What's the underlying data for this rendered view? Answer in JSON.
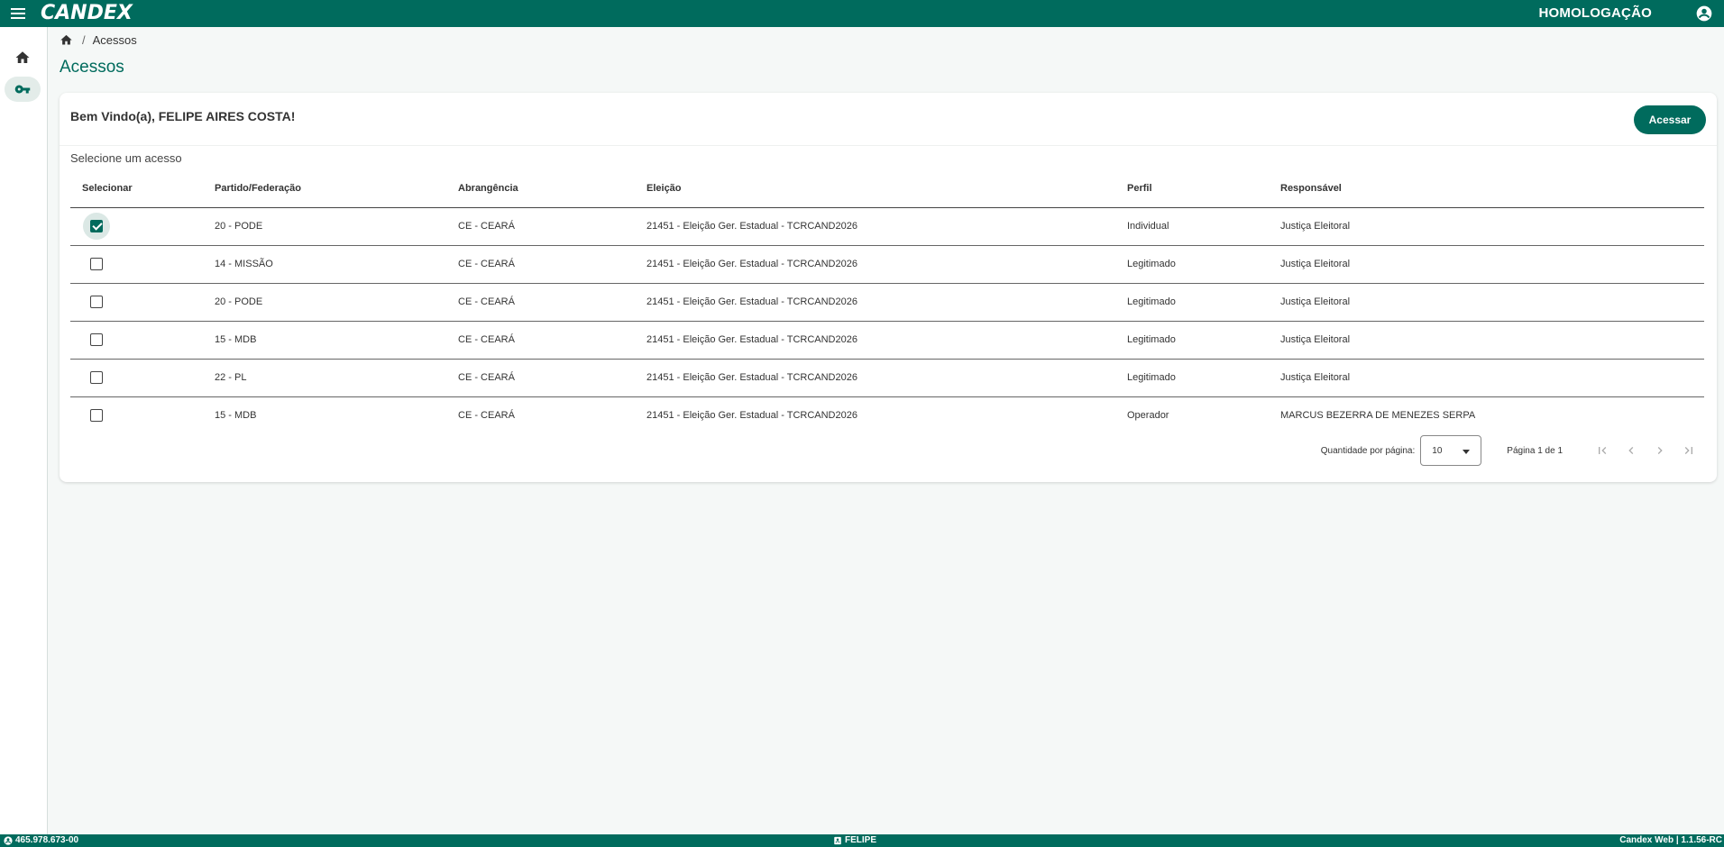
{
  "header": {
    "logo_text": "CANDEX",
    "environment": "HOMOLOGAÇÃO"
  },
  "breadcrumb": {
    "current": "Acessos"
  },
  "page": {
    "title": "Acessos"
  },
  "card": {
    "welcome": "Bem Vindo(a), FELIPE AIRES COSTA!",
    "action_label": "Acessar",
    "subtitle": "Selecione um acesso"
  },
  "table": {
    "columns": [
      "Selecionar",
      "Partido/Federação",
      "Abrangência",
      "Eleição",
      "Perfil",
      "Responsável"
    ],
    "rows": [
      {
        "checked": true,
        "partido": "20 - PODE",
        "abrangencia": "CE - CEARÁ",
        "eleicao": "21451 - Eleição Ger. Estadual - TCRCAND2026",
        "perfil": "Individual",
        "responsavel": "Justiça Eleitoral"
      },
      {
        "checked": false,
        "partido": "14 - MISSÃO",
        "abrangencia": "CE - CEARÁ",
        "eleicao": "21451 - Eleição Ger. Estadual - TCRCAND2026",
        "perfil": "Legitimado",
        "responsavel": "Justiça Eleitoral"
      },
      {
        "checked": false,
        "partido": "20 - PODE",
        "abrangencia": "CE - CEARÁ",
        "eleicao": "21451 - Eleição Ger. Estadual - TCRCAND2026",
        "perfil": "Legitimado",
        "responsavel": "Justiça Eleitoral"
      },
      {
        "checked": false,
        "partido": "15 - MDB",
        "abrangencia": "CE - CEARÁ",
        "eleicao": "21451 - Eleição Ger. Estadual - TCRCAND2026",
        "perfil": "Legitimado",
        "responsavel": "Justiça Eleitoral"
      },
      {
        "checked": false,
        "partido": "22 - PL",
        "abrangencia": "CE - CEARÁ",
        "eleicao": "21451 - Eleição Ger. Estadual - TCRCAND2026",
        "perfil": "Legitimado",
        "responsavel": "Justiça Eleitoral"
      },
      {
        "checked": false,
        "partido": "15 - MDB",
        "abrangencia": "CE - CEARÁ",
        "eleicao": "21451 - Eleição Ger. Estadual - TCRCAND2026",
        "perfil": "Operador",
        "responsavel": "MARCUS BEZERRA DE MENEZES SERPA"
      }
    ]
  },
  "paginator": {
    "page_size_label": "Quantidade por página:",
    "page_size_value": "10",
    "range_label": "Página 1 de 1"
  },
  "footer": {
    "cpf": "465.978.673-00",
    "user": "FELIPE",
    "version": "Candex Web | 1.1.56-RC"
  },
  "colors": {
    "primary": "#006b5d",
    "background": "#f5f8f7"
  },
  "icons": {
    "menu": "menu-icon",
    "account": "account-circle-icon",
    "home": "home-icon",
    "key": "key-icon"
  }
}
